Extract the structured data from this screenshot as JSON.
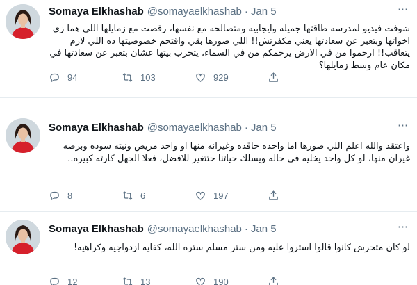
{
  "tweets": [
    {
      "name": "Somaya Elkhashab",
      "handle": "@somayaelkhashab",
      "separator": "·",
      "date": "Jan 5",
      "text": "شوفت فيديو لمدرسه طاقتها جميله وايجابيه ومتصالحه مع نفسها، رقصت مع زمايلها اللي هما زي اخواتها وبتعبر عن سعادتها يعني مكفرتش!! اللي صورها بقي واقتحم خصوصيتها ده اللي لازم يتعاقب!! ارحموا من في الارض يرحمكم من في السماء، يتخرب بيتها عشان بتعبر عن سعادتها في مكان عام وسط زمايلها؟",
      "replies": "94",
      "retweets": "103",
      "likes": "929"
    },
    {
      "name": "Somaya Elkhashab",
      "handle": "@somayaelkhashab",
      "separator": "·",
      "date": "Jan 5",
      "text": "واعتقد والله اعلم اللي صورها اما واحده حاقده وغيرانه منها او واحد مريض ونيته سوده وبرضه غيران منها، لو كل واحد يخليه في حاله ويسلك حياتنا حتتغير للافضل، فعلا الجهل كارثه كبيره..",
      "replies": "8",
      "retweets": "6",
      "likes": "197"
    },
    {
      "name": "Somaya Elkhashab",
      "handle": "@somayaelkhashab",
      "separator": "·",
      "date": "Jan 5",
      "text": "لو كان متحرش كانوا قالوا استروا عليه ومن ستر مسلم ستره الله، كفايه ازدواجيه وكراهيه!",
      "replies": "12",
      "retweets": "13",
      "likes": "190"
    }
  ],
  "colors": {
    "text": "#0f1419",
    "muted": "#5b7083",
    "divider": "#e6ecf0",
    "avatar_dress": "#d6202b"
  },
  "icons": [
    "reply-icon",
    "retweet-icon",
    "like-icon",
    "share-icon",
    "more-icon"
  ]
}
